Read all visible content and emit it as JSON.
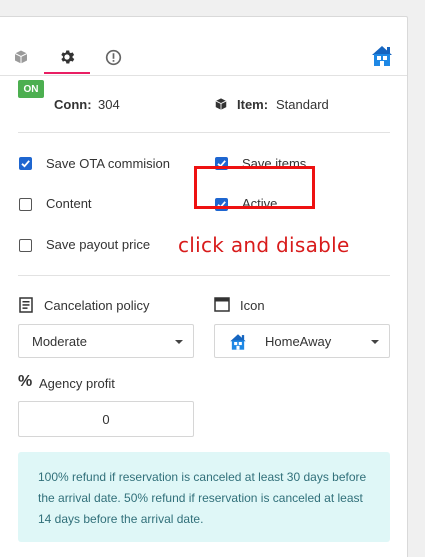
{
  "tabs": [
    {
      "name": "box",
      "icon": "box-icon"
    },
    {
      "name": "settings",
      "icon": "gear-icon",
      "active": true
    },
    {
      "name": "alerts",
      "icon": "alert-circle-icon"
    }
  ],
  "brand_icon": "homeaway-house-icon",
  "connection": {
    "badge": "ON",
    "label": "Conn:",
    "value": "304"
  },
  "item": {
    "label": "Item:",
    "value": "Standard",
    "icon": "cube-icon"
  },
  "checkboxes": {
    "save_ota": {
      "label": "Save OTA commision",
      "checked": true
    },
    "save_items": {
      "label": "Save items",
      "checked": true
    },
    "content": {
      "label": "Content",
      "checked": false
    },
    "active": {
      "label": "Active",
      "checked": true
    },
    "save_payout": {
      "label": "Save payout price",
      "checked": false
    }
  },
  "annotation": "click and disable",
  "cancelation": {
    "label": "Cancelation policy",
    "value": "Moderate",
    "icon": "document-icon"
  },
  "icon_select": {
    "label": "Icon",
    "value": "HomeAway",
    "icon": "window-icon"
  },
  "agency": {
    "label": "Agency profit",
    "value": "0",
    "icon": "percent-icon"
  },
  "info_text": "100% refund if reservation is canceled at least 30 days before the arrival date. 50% refund if reservation is canceled at least 14 days before the arrival date.",
  "colors": {
    "accent": "#e91e63",
    "checkbox": "#1e66d0",
    "badge": "#4caf50",
    "annotation": "#d81b1b",
    "info_bg": "#dff7f7"
  }
}
